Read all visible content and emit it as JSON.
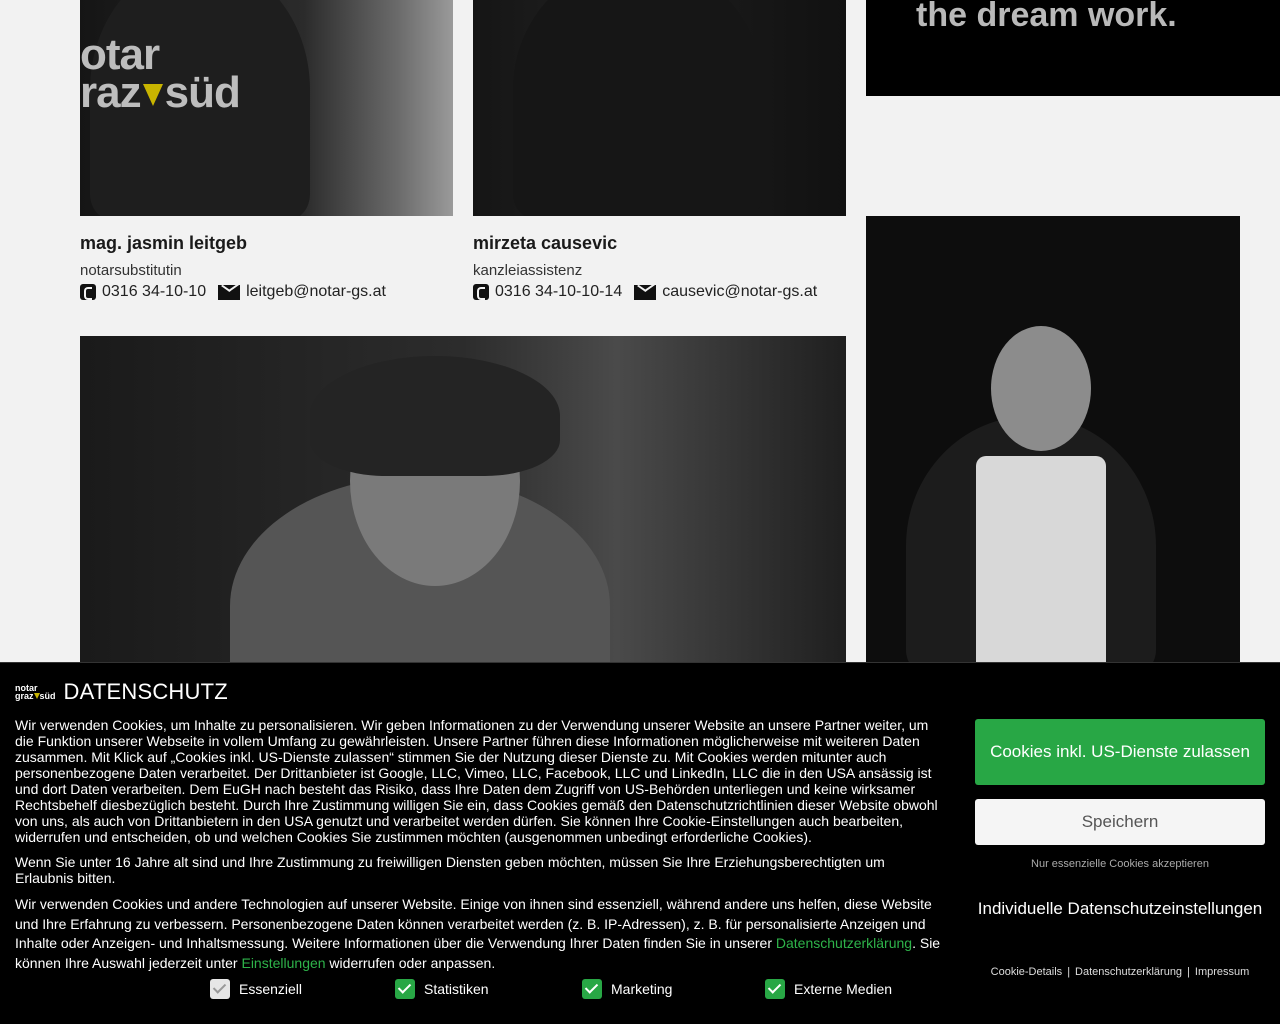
{
  "page": {
    "logo_line1": "otar",
    "logo_line2a": "raz",
    "logo_line2b": "süd",
    "tagline": "the dream work."
  },
  "people": [
    {
      "name": "mag. jasmin leitgeb",
      "role": "notarsubstitutin",
      "phone": "0316 34-10-10",
      "email": "leitgeb@notar-gs.at"
    },
    {
      "name": "mirzeta causevic",
      "role": "kanzleiassistenz",
      "phone": "0316 34-10-10-14",
      "email": "causevic@notar-gs.at"
    }
  ],
  "banner": {
    "logo_line1": "notar",
    "logo_line2a": "graz",
    "logo_line2b": "süd",
    "title": "DATENSCHUTZ",
    "p1": "Wir verwenden Cookies, um Inhalte zu personalisieren. Wir geben Informationen zu der Verwendung unserer Website an unsere Partner weiter, um die Funktion unserer Webseite in vollem Umfang zu gewährleisten. Unsere Partner führen diese Informationen möglicherweise mit weiteren Daten zusammen. Mit Klick auf „Cookies inkl. US-Dienste zulassen“ stimmen Sie der Nutzung dieser Dienste zu. Mit Cookies werden mitunter auch personenbezogene Daten verarbeitet. Der Drittanbieter ist Google, LLC, Vimeo, LLC, Facebook, LLC und LinkedIn, LLC die in den USA ansässig ist und dort Daten verarbeiten. Dem EuGH nach besteht das Risiko, dass Ihre Daten dem Zugriff von US-Behörden unterliegen und keine wirksamer Rechtsbehelf diesbezüglich besteht. Durch Ihre Zustimmung willigen Sie ein, dass Cookies gemäß den Datenschutzrichtlinien dieser Website obwohl von uns, als auch von Drittanbietern in den USA genutzt und verarbeitet werden dürfen. Sie können Ihre Cookie-Einstellungen auch bearbeiten, widerrufen und entscheiden, ob und welchen Cookies Sie zustimmen möchten (ausgenommen unbedingt erforderliche Cookies).",
    "p2": "Wenn Sie unter 16 Jahre alt sind und Ihre Zustimmung zu freiwilligen Diensten geben möchten, müssen Sie Ihre Erziehungsberechtigten um Erlaubnis bitten.",
    "p3_a": "Wir verwenden Cookies und andere Technologien auf unserer Website. Einige von ihnen sind essenziell, während andere uns helfen, diese Website und Ihre Erfahrung zu verbessern. Personenbezogene Daten können verarbeitet werden (z. B. IP-Adressen), z. B. für personalisierte Anzeigen und Inhalte oder Anzeigen- und Inhaltsmessung. Weitere Informationen über die Verwendung Ihrer Daten finden Sie in unserer ",
    "p3_link1": "Datenschutzerklärung",
    "p3_b": ". Sie können Ihre Auswahl jederzeit unter ",
    "p3_link2": "Einstellungen",
    "p3_c": " widerrufen oder anpassen.",
    "checkboxes": [
      {
        "label": "Essenziell",
        "checked": true,
        "disabled": true
      },
      {
        "label": "Statistiken",
        "checked": true,
        "disabled": false
      },
      {
        "label": "Marketing",
        "checked": true,
        "disabled": false
      },
      {
        "label": "Externe Medien",
        "checked": true,
        "disabled": false
      }
    ],
    "accept_label": "Cookies inkl. US-Dienste zulassen",
    "save_label": "Speichern",
    "only_essential_label": "Nur essenzielle Cookies akzeptieren",
    "individual_label": "Individuelle Datenschutzeinstellungen",
    "footer_links": [
      "Cookie-Details",
      "Datenschutzerklärung",
      "Impressum"
    ],
    "accent_color": "#28a745",
    "link_color": "#2eb34a"
  }
}
